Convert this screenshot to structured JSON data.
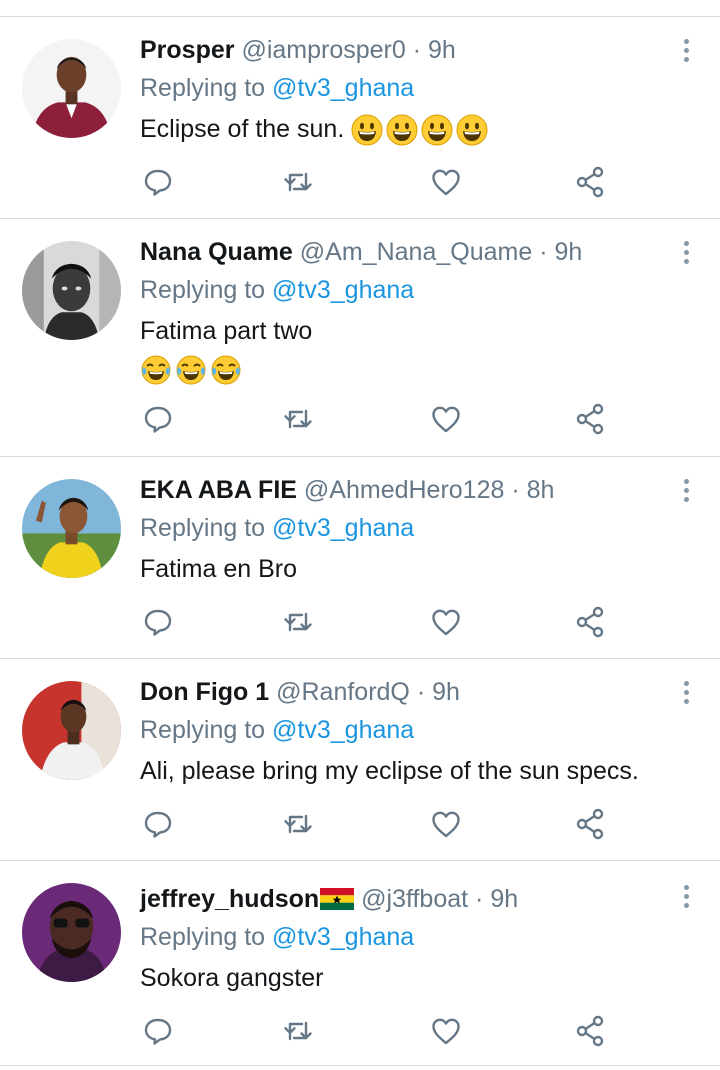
{
  "replying_label": "Replying to",
  "tweets": [
    {
      "name": "Prosper",
      "handle": "@iamprosper0",
      "time": "9h",
      "replying_to": "@tv3_ghana",
      "text": "Eclipse of the sun.",
      "text_line2": "",
      "emojis": [
        "grinning-face",
        "grinning-face",
        "grinning-face",
        "grinning-face"
      ],
      "flag": ""
    },
    {
      "name": "Nana Quame",
      "handle": "@Am_Nana_Quame",
      "time": "9h",
      "replying_to": "@tv3_ghana",
      "text": "Fatima part two",
      "emojis": [
        "tears-of-joy-face",
        "tears-of-joy-face",
        "tears-of-joy-face"
      ],
      "flag": ""
    },
    {
      "name": "EKA ABA FIE",
      "handle": "@AhmedHero128",
      "time": "8h",
      "replying_to": "@tv3_ghana",
      "text": "Fatima en Bro",
      "emojis": [],
      "flag": ""
    },
    {
      "name": "Don Figo 1",
      "handle": "@RanfordQ",
      "time": "9h",
      "replying_to": "@tv3_ghana",
      "text": "Ali, please bring my eclipse of the sun specs.",
      "emojis": [],
      "flag": ""
    },
    {
      "name": "jeffrey_hudson",
      "handle": "@j3ffboat",
      "time": "9h",
      "replying_to": "@tv3_ghana",
      "text": "Sokora gangster",
      "emojis": [],
      "flag": "ghana-flag-emoji"
    }
  ],
  "icons": {
    "reply": "reply-icon",
    "retweet": "retweet-icon",
    "like": "like-icon",
    "share": "share-icon",
    "more": "more-options-icon"
  },
  "colors": {
    "mention": "#1b95e0",
    "secondary": "#657786",
    "icon": "#657786",
    "divider": "#d7dde2"
  }
}
